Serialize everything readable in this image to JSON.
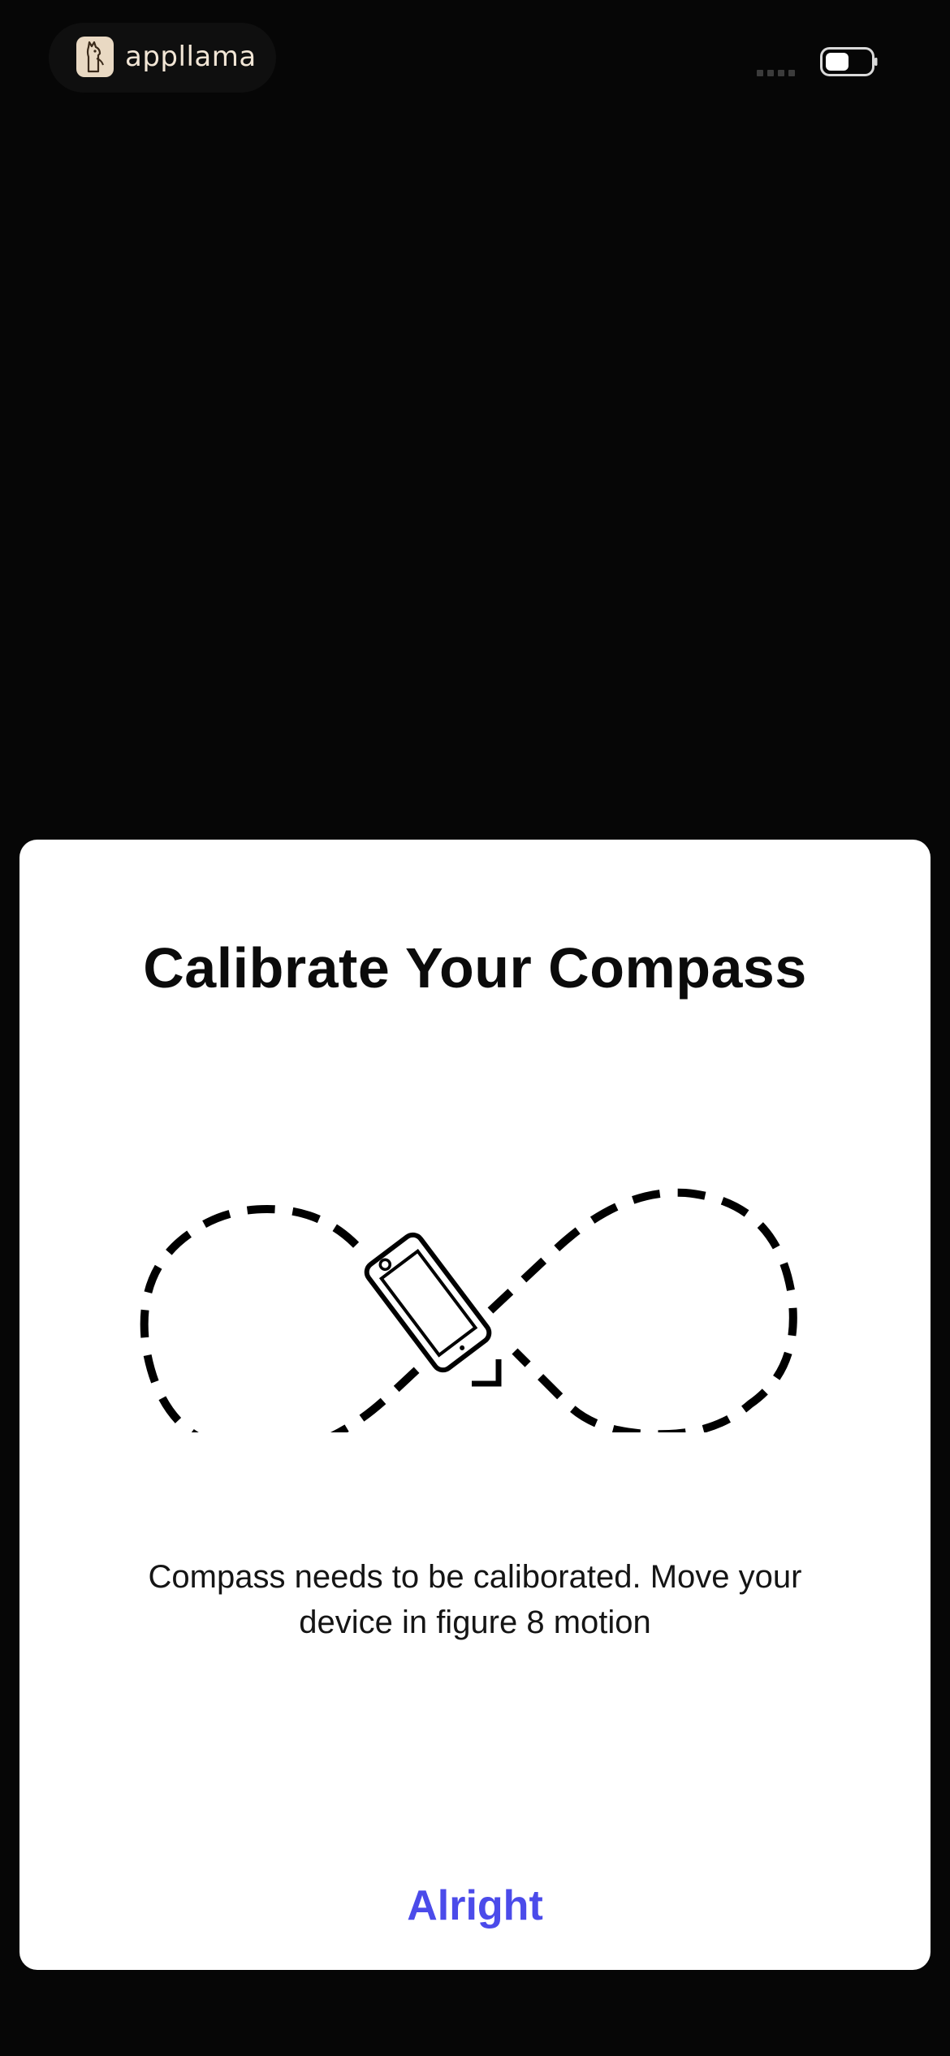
{
  "status_bar": {
    "brand_name": "appllama",
    "logo_icon": "llama-icon",
    "signal_icon": "signal-dots-icon",
    "battery_icon": "battery-icon"
  },
  "modal": {
    "title": "Calibrate Your Compass",
    "illustration_icon": "figure-eight-phone-icon",
    "message": "Compass needs to be caliborated. Move your device in figure 8 motion",
    "button_label": "Alright"
  },
  "colors": {
    "background": "#060606",
    "modal_background": "#ffffff",
    "accent": "#4b4bea",
    "title_text": "#0b0b0b"
  }
}
